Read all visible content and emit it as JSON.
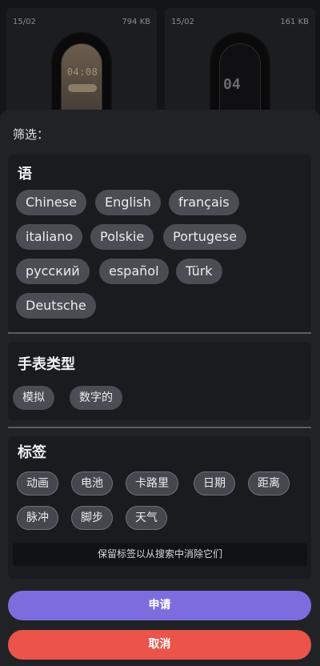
{
  "background": {
    "cards": [
      {
        "date": "15/02",
        "size": "794 KB",
        "time": "04:08"
      },
      {
        "date": "15/02",
        "size": "161 KB",
        "time": "04"
      }
    ]
  },
  "filter": {
    "title": "筛选：",
    "language": {
      "heading": "语",
      "chips": [
        "Chinese",
        "English",
        "français",
        "italiano",
        "Polskie",
        "Portugese",
        "русский",
        "español",
        "Türk",
        "Deutsche"
      ]
    },
    "watch_type": {
      "heading": "手表类型",
      "chips": [
        "模拟",
        "数字的"
      ]
    },
    "tags": {
      "heading": "标签",
      "chips": [
        "动画",
        "电池",
        "卡路里",
        "日期",
        "距离",
        "脉冲",
        "脚步",
        "天气"
      ],
      "note": "保留标签以从搜索中消除它们"
    },
    "apply_label": "申请",
    "cancel_label": "取消"
  },
  "colors": {
    "apply": "#7b6ddd",
    "cancel": "#ea544a",
    "chip": "#4a4d54"
  }
}
